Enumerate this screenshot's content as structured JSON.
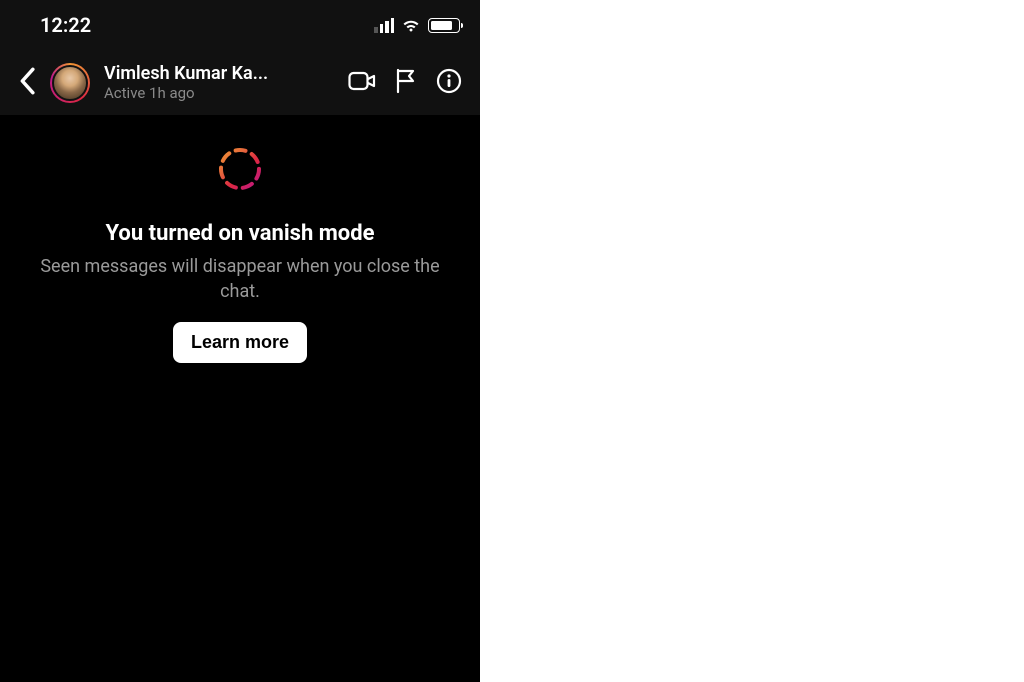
{
  "status_bar": {
    "time": "12:22"
  },
  "header": {
    "user_name": "Vimlesh Kumar Ka...",
    "user_status": "Active 1h ago"
  },
  "vanish": {
    "title": "You turned on vanish mode",
    "subtitle": "Seen messages will disappear when you close the chat.",
    "button_label": "Learn more"
  }
}
